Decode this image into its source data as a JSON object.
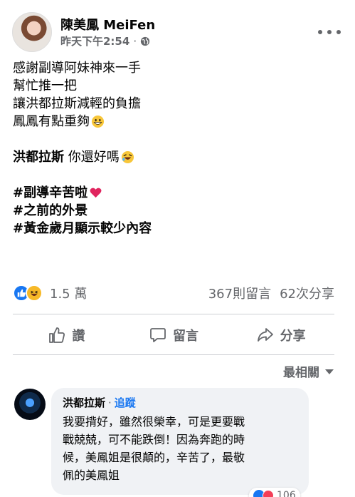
{
  "post": {
    "author": "陳美鳳 MeiFen",
    "time": "昨天下午2:54",
    "separator": "·",
    "lines": [
      {
        "type": "text",
        "text": "感謝副導阿妹神來一手"
      },
      {
        "type": "text",
        "text": "幫忙推一把"
      },
      {
        "type": "text",
        "text": "讓洪都拉斯減輕的負擔"
      },
      {
        "type": "text_emoji",
        "text": "鳳鳳有點重夠",
        "emoji": "grinning-face-emoji"
      },
      {
        "type": "blank"
      },
      {
        "type": "mention",
        "mention": "洪都拉斯",
        "text": " 你還好嗎",
        "emoji": "rofl-emoji"
      },
      {
        "type": "blank"
      },
      {
        "type": "hashtag",
        "text": "#副導辛苦啦",
        "emoji": "red-heart-emoji"
      },
      {
        "type": "hashtag",
        "text": "#之前的外景"
      },
      {
        "type": "hashtag",
        "text": "#黃金歲月顯示較少內容"
      }
    ]
  },
  "reactions": {
    "count": "1.5 萬",
    "comments": "367則留言",
    "shares": "62次分享"
  },
  "actions": {
    "like": "讚",
    "comment": "留言",
    "share": "分享"
  },
  "sort": {
    "label": "最相關"
  },
  "comment": {
    "author": "洪都拉斯",
    "separator": "·",
    "follow": "追蹤",
    "lines": [
      "我要揹好，雖然很榮幸，可是更要戰",
      "戰兢兢，可不能跌倒！因為奔跑的時",
      "候，美鳳姐是很顛的，辛苦了，最敬",
      "佩的美鳳姐"
    ],
    "reaction_count": "106"
  },
  "colors": {
    "brand_blue": "#1877f2",
    "secondary_text": "#65676b",
    "bubble_bg": "#f0f2f5"
  }
}
